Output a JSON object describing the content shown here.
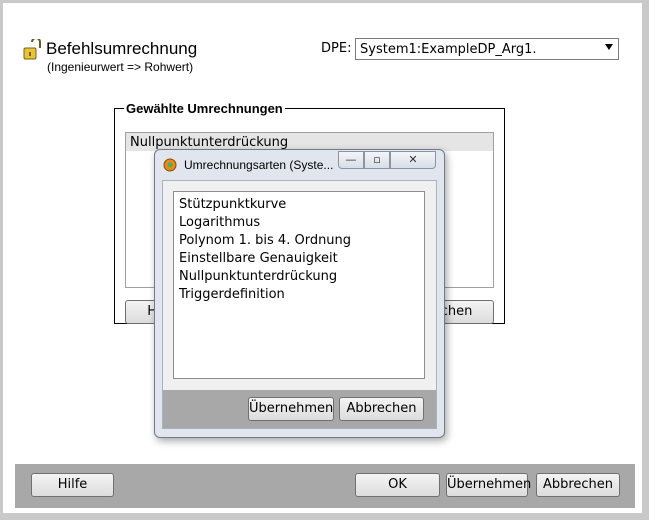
{
  "header": {
    "title": "Befehlsumrechnung",
    "subtitle": "(Ingenieurwert => Rohwert)",
    "icon": "lock-open-icon"
  },
  "dpe": {
    "label": "DPE:",
    "value": "System1:ExampleDP_Arg1."
  },
  "group": {
    "legend": "Gewählte Umrechnungen",
    "items": [
      "Nullpunktunterdrückung"
    ],
    "left_button_label": "Hi",
    "right_button_label": "chen"
  },
  "footer": {
    "help": "Hilfe",
    "ok": "OK",
    "apply": "Übernehmen",
    "cancel": "Abbrechen"
  },
  "dialog": {
    "title": "Umrechnungsarten (Syste...",
    "items": [
      "Stützpunktkurve",
      "Logarithmus",
      "Polynom 1. bis 4. Ordnung",
      "Einstellbare Genauigkeit",
      "Nullpunktunterdrückung",
      "Triggerdefinition"
    ],
    "apply": "Übernehmen",
    "cancel": "Abbrechen",
    "minimize_glyph": "—",
    "maximize_glyph": "▫",
    "close_glyph": "✕"
  }
}
